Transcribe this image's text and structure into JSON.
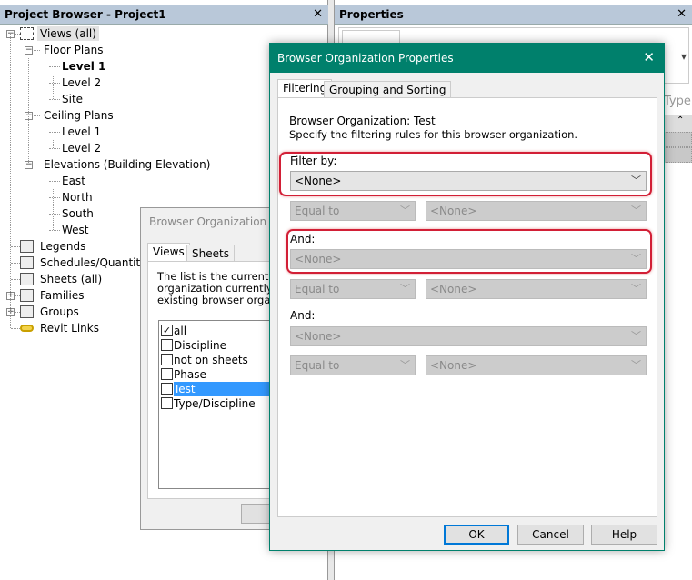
{
  "project_browser": {
    "title": "Project Browser - Project1",
    "close": "✕",
    "tree": [
      {
        "label": "Views (all)",
        "depth": 0,
        "expander": "−",
        "icon": "views-icon",
        "selected": true
      },
      {
        "label": "Floor Plans",
        "depth": 1,
        "expander": "−"
      },
      {
        "label": "Level 1",
        "depth": 2,
        "bold": true
      },
      {
        "label": "Level 2",
        "depth": 2
      },
      {
        "label": "Site",
        "depth": 2
      },
      {
        "label": "Ceiling Plans",
        "depth": 1,
        "expander": "−"
      },
      {
        "label": "Level 1",
        "depth": 2
      },
      {
        "label": "Level 2",
        "depth": 2
      },
      {
        "label": "Elevations (Building Elevation)",
        "depth": 1,
        "expander": "−"
      },
      {
        "label": "East",
        "depth": 2
      },
      {
        "label": "North",
        "depth": 2
      },
      {
        "label": "South",
        "depth": 2
      },
      {
        "label": "West",
        "depth": 2
      },
      {
        "label": "Legends",
        "depth": 0,
        "icon": "legends-icon"
      },
      {
        "label": "Schedules/Quantities",
        "depth": 0,
        "icon": "schedules-icon"
      },
      {
        "label": "Sheets (all)",
        "depth": 0,
        "icon": "sheets-icon"
      },
      {
        "label": "Families",
        "depth": 0,
        "expander": "+",
        "icon": "families-icon"
      },
      {
        "label": "Groups",
        "depth": 0,
        "expander": "+",
        "icon": "groups-icon"
      },
      {
        "label": "Revit Links",
        "depth": 0,
        "icon": "revit-links-icon"
      }
    ]
  },
  "properties": {
    "title": "Properties",
    "close": "✕",
    "type_label": "Type",
    "dropdown_arrow": "▾",
    "collapse": "⌃"
  },
  "browser_org": {
    "title": "Browser Organization",
    "tabs": [
      "Views",
      "Sheets"
    ],
    "description": [
      "The list is the currently de",
      "organization currently in u",
      "existing browser organiza"
    ],
    "items": [
      {
        "label": "all",
        "checked": true
      },
      {
        "label": "Discipline",
        "checked": false
      },
      {
        "label": "not on sheets",
        "checked": false
      },
      {
        "label": "Phase",
        "checked": false
      },
      {
        "label": "Test",
        "checked": false,
        "selected": true
      },
      {
        "label": "Type/Discipline",
        "checked": false
      }
    ],
    "button_partial": "O"
  },
  "bop": {
    "title": "Browser Organization Properties",
    "close": "✕",
    "accent": "#00806c",
    "tabs": [
      "Filtering",
      "Grouping and Sorting"
    ],
    "org_line": "Browser Organization: Test",
    "instruction": "Specify the filtering rules for this browser organization.",
    "filter_label": "Filter by:",
    "filter_value": "<None>",
    "op1": "Equal to",
    "val1": "<None>",
    "and1_label": "And:",
    "and1_value": "<None>",
    "op2": "Equal to",
    "val2": "<None>",
    "and2_label": "And:",
    "and2_value": "<None>",
    "op3": "Equal to",
    "val3": "<None>",
    "ok": "OK",
    "cancel": "Cancel",
    "help": "Help",
    "highlight_color": "#d21f36"
  }
}
